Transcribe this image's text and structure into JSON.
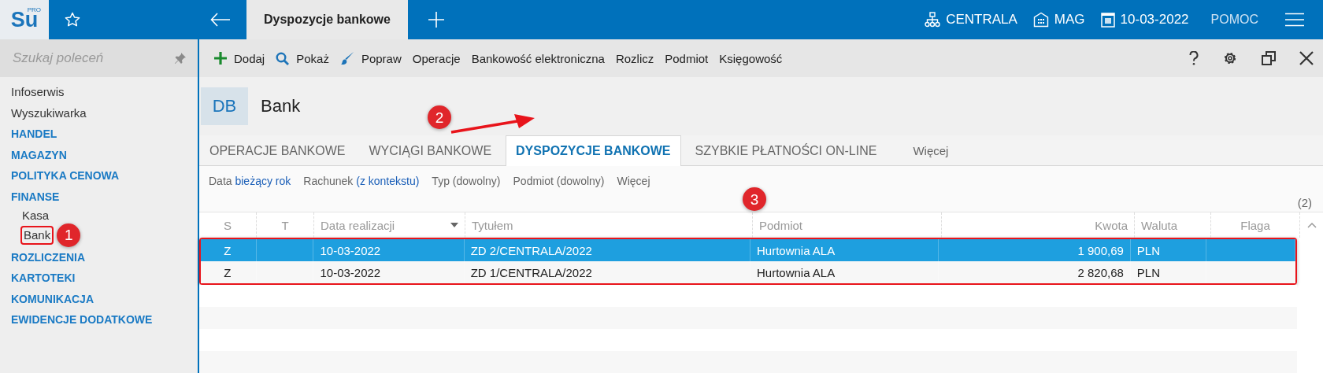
{
  "top_bar": {
    "logo": "Su",
    "logo_badge": "PRO",
    "open_tab": {
      "label": "Dyspozycje bankowe",
      "selected": true
    },
    "context": [
      {
        "kind": "branch",
        "label": "CENTRALA"
      },
      {
        "kind": "warehouse",
        "label": "MAG"
      },
      {
        "kind": "date",
        "label": "10-03-2022"
      }
    ],
    "help": "POMOC"
  },
  "sidebar": {
    "search": {
      "placeholder": "Szukaj poleceń"
    },
    "items": [
      {
        "label": "Infoserwis",
        "kind": "link"
      },
      {
        "label": "Wyszukiwarka",
        "kind": "link"
      },
      {
        "label": "HANDEL",
        "kind": "section"
      },
      {
        "label": "MAGAZYN",
        "kind": "section"
      },
      {
        "label": "POLITYKA CENOWA",
        "kind": "section"
      },
      {
        "label": "FINANSE",
        "kind": "section",
        "children": [
          {
            "label": "Kasa",
            "highlighted": false
          },
          {
            "label": "Bank",
            "highlighted": true
          }
        ]
      },
      {
        "label": "ROZLICZENIA",
        "kind": "section"
      },
      {
        "label": "KARTOTEKI",
        "kind": "section"
      },
      {
        "label": "KOMUNIKACJA",
        "kind": "section"
      },
      {
        "label": "EWIDENCJE DODATKOWE",
        "kind": "section"
      }
    ]
  },
  "toolbar": {
    "actions": [
      {
        "label": "Dodaj",
        "kind": "add"
      },
      {
        "label": "Pokaż",
        "kind": "view"
      },
      {
        "label": "Popraw",
        "kind": "edit"
      },
      {
        "label": "Operacje",
        "kind": "plain"
      },
      {
        "label": "Bankowość elektroniczna",
        "kind": "plain"
      },
      {
        "label": "Rozlicz",
        "kind": "plain"
      },
      {
        "label": "Podmiot",
        "kind": "plain"
      },
      {
        "label": "Księgowość",
        "kind": "plain"
      }
    ]
  },
  "page_header": {
    "badge": "DB",
    "title": "Bank"
  },
  "tabs": [
    {
      "label": "OPERACJE BANKOWE",
      "selected": false
    },
    {
      "label": "WYCIĄGI BANKOWE",
      "selected": false
    },
    {
      "label": "DYSPOZYCJE BANKOWE",
      "selected": true
    },
    {
      "label": "SZYBKIE PŁATNOŚCI ON-LINE",
      "selected": false
    }
  ],
  "tabs_more": "Więcej",
  "filters": [
    {
      "label": "Data",
      "value": "bieżący rok",
      "set": true
    },
    {
      "label": "Rachunek",
      "value": "(z kontekstu)",
      "set": true
    },
    {
      "label": "Typ",
      "value": "(dowolny)",
      "set": false
    },
    {
      "label": "Podmiot",
      "value": "(dowolny)",
      "set": false
    }
  ],
  "filters_more": "Więcej",
  "table": {
    "count": "(2)",
    "highlighted": true,
    "columns": [
      {
        "label": "S",
        "sorted": false
      },
      {
        "label": "T",
        "sorted": false
      },
      {
        "label": "Data realizacji",
        "sorted": true
      },
      {
        "label": "Tytułem",
        "sorted": false
      },
      {
        "label": "Podmiot",
        "sorted": false
      },
      {
        "label": "Kwota",
        "sorted": false
      },
      {
        "label": "Waluta",
        "sorted": false
      },
      {
        "label": "Flaga",
        "sorted": false
      }
    ],
    "rows": [
      {
        "selected": true,
        "cells": [
          "Z",
          "",
          "10-03-2022",
          "ZD 2/CENTRALA/2022",
          "Hurtownia ALA",
          "1 900,69",
          "PLN",
          ""
        ]
      },
      {
        "selected": false,
        "cells": [
          "Z",
          "",
          "10-03-2022",
          "ZD 1/CENTRALA/2022",
          "Hurtownia ALA",
          "2 820,68",
          "PLN",
          ""
        ]
      }
    ]
  },
  "annotations": [
    {
      "number": "1",
      "kind": "sidebar"
    },
    {
      "number": "2",
      "kind": "tab"
    },
    {
      "number": "3",
      "kind": "table"
    }
  ]
}
